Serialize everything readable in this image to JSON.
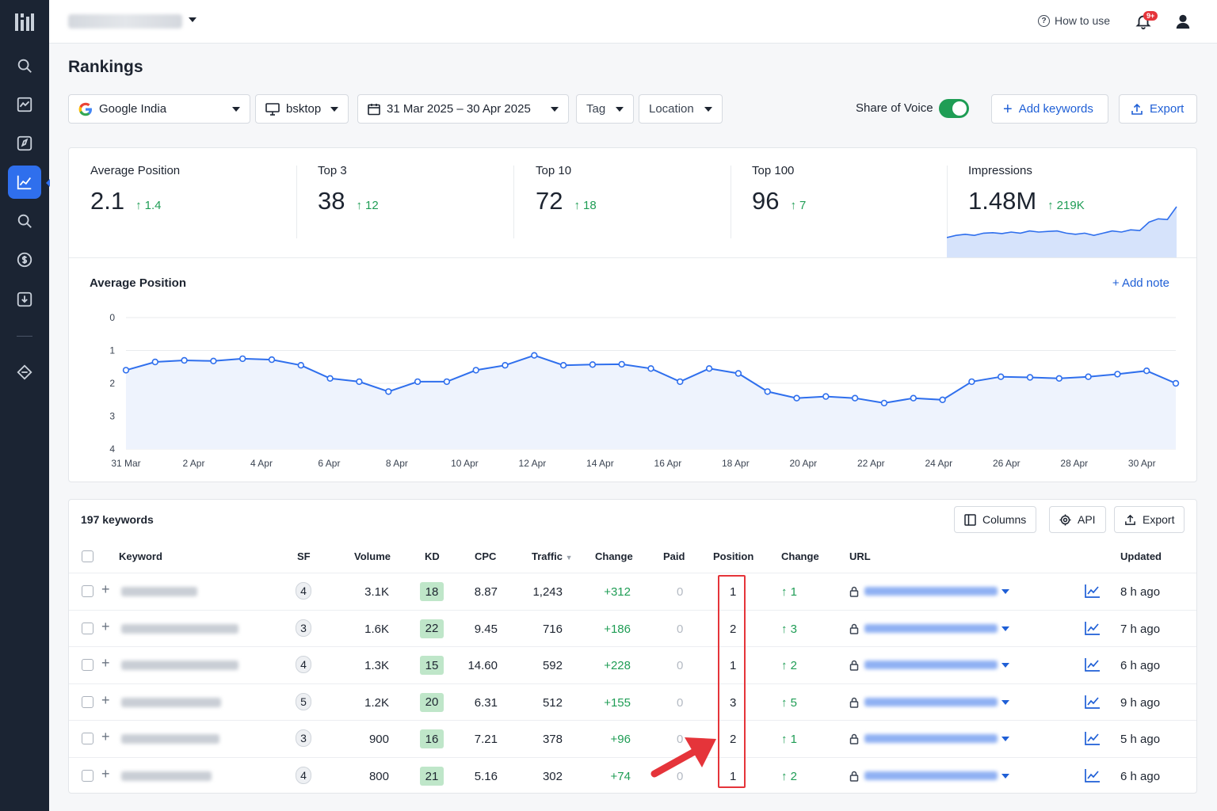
{
  "header": {
    "how_to_use": "How to use",
    "notification_badge": "9+"
  },
  "page": {
    "title": "Rankings"
  },
  "filters": {
    "engine": "Google India",
    "device": "bsktop",
    "date_range": "31 Mar 2025 – 30 Apr 2025",
    "tag": "Tag",
    "location": "Location",
    "share_of_voice_label": "Share of Voice",
    "share_of_voice_on": true,
    "add_keywords": "Add keywords",
    "export": "Export"
  },
  "stats": [
    {
      "label": "Average Position",
      "value": "2.1",
      "change": "1.4"
    },
    {
      "label": "Top 3",
      "value": "38",
      "change": "12"
    },
    {
      "label": "Top 10",
      "value": "72",
      "change": "18"
    },
    {
      "label": "Top 100",
      "value": "96",
      "change": "7"
    },
    {
      "label": "Impressions",
      "value": "1.48M",
      "change": "219K"
    }
  ],
  "chart_data": [
    {
      "type": "area",
      "title": "Impressions",
      "values": [
        0.9,
        1.0,
        1.05,
        1.0,
        1.1,
        1.12,
        1.08,
        1.15,
        1.1,
        1.2,
        1.15,
        1.18,
        1.2,
        1.1,
        1.05,
        1.1,
        1.0,
        1.1,
        1.2,
        1.15,
        1.25,
        1.22,
        1.6,
        1.75,
        1.72,
        2.3
      ]
    },
    {
      "type": "line",
      "title": "Average Position",
      "add_note": "Add note",
      "x_tick_labels": [
        "31 Mar",
        "2 Apr",
        "4 Apr",
        "6 Apr",
        "8 Apr",
        "10 Apr",
        "12 Apr",
        "14 Apr",
        "16 Apr",
        "18 Apr",
        "20 Apr",
        "22 Apr",
        "24 Apr",
        "26 Apr",
        "28 Apr",
        "30 Apr"
      ],
      "y_ticks": [
        0,
        1,
        2,
        3,
        4
      ],
      "ylim": [
        0,
        4
      ],
      "y_inverted": true,
      "grid": true,
      "color": "#2f6fed",
      "values": [
        1.6,
        1.35,
        1.3,
        1.32,
        1.25,
        1.28,
        1.45,
        1.85,
        1.95,
        2.25,
        1.95,
        1.95,
        1.6,
        1.45,
        1.15,
        1.45,
        1.43,
        1.42,
        1.55,
        1.95,
        1.55,
        1.7,
        2.25,
        2.45,
        2.4,
        2.45,
        2.6,
        2.45,
        2.5,
        1.95,
        1.8,
        1.82,
        1.85,
        1.8,
        1.72,
        1.62,
        2.0
      ]
    }
  ],
  "table": {
    "count_label": "197 keywords",
    "buttons": {
      "columns": "Columns",
      "api": "API",
      "export": "Export"
    },
    "headers": {
      "keyword": "Keyword",
      "sf": "SF",
      "volume": "Volume",
      "kd": "KD",
      "cpc": "CPC",
      "traffic": "Traffic",
      "change": "Change",
      "paid": "Paid",
      "position": "Position",
      "pos_change": "Change",
      "url": "URL",
      "updated": "Updated"
    },
    "rows": [
      {
        "sf": "4",
        "volume": "3.1K",
        "kd": "18",
        "cpc": "8.87",
        "traffic": "1,243",
        "change": "+312",
        "paid": "0",
        "position": "1",
        "pos_change": "1",
        "updated": "8 h ago"
      },
      {
        "sf": "3",
        "volume": "1.6K",
        "kd": "22",
        "cpc": "9.45",
        "traffic": "716",
        "change": "+186",
        "paid": "0",
        "position": "2",
        "pos_change": "3",
        "updated": "7 h ago"
      },
      {
        "sf": "4",
        "volume": "1.3K",
        "kd": "15",
        "cpc": "14.60",
        "traffic": "592",
        "change": "+228",
        "paid": "0",
        "position": "1",
        "pos_change": "2",
        "updated": "6 h ago"
      },
      {
        "sf": "5",
        "volume": "1.2K",
        "kd": "20",
        "cpc": "6.31",
        "traffic": "512",
        "change": "+155",
        "paid": "0",
        "position": "3",
        "pos_change": "5",
        "updated": "9 h ago"
      },
      {
        "sf": "3",
        "volume": "900",
        "kd": "16",
        "cpc": "7.21",
        "traffic": "378",
        "change": "+96",
        "paid": "0",
        "position": "2",
        "pos_change": "1",
        "updated": "5 h ago"
      },
      {
        "sf": "4",
        "volume": "800",
        "kd": "21",
        "cpc": "5.16",
        "traffic": "302",
        "change": "+74",
        "paid": "0",
        "position": "1",
        "pos_change": "2",
        "updated": "6 h ago"
      }
    ]
  },
  "colors": {
    "accent": "#2f6fed",
    "positive": "#1f9d55",
    "highlight": "#e5343a",
    "sidebar": "#1b2433"
  }
}
